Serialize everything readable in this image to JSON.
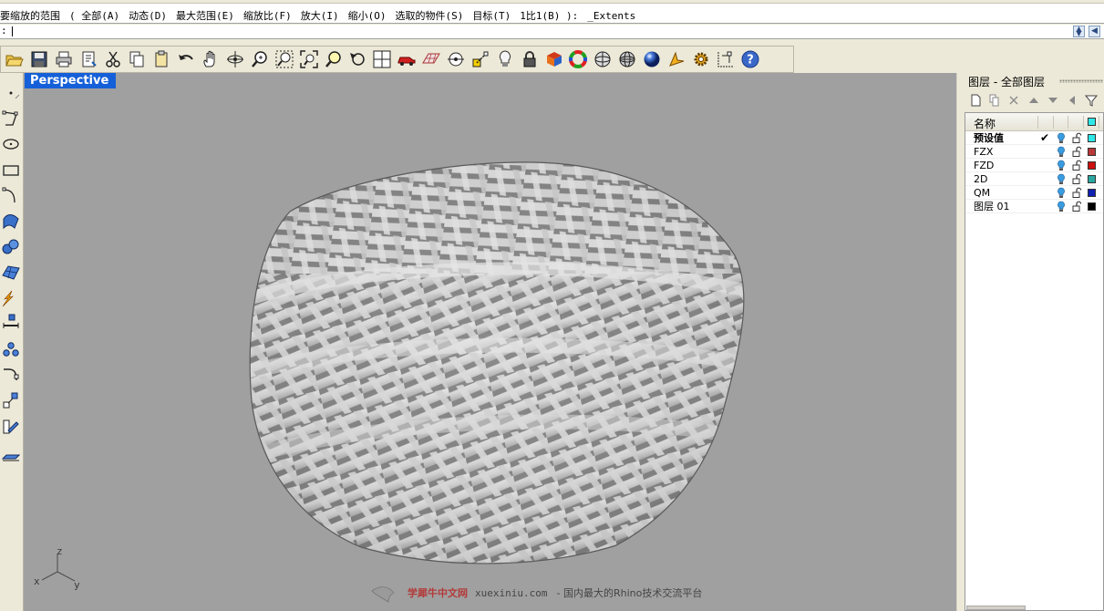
{
  "command_history": {
    "items": [
      "要缩放的范围",
      "( 全部(A)",
      "动态(D)",
      "最大范围(E)",
      "缩放比(F)",
      "放大(I)",
      "缩小(O)",
      "选取的物件(S)",
      "目标(T)",
      "1比1(B) ):",
      "_Extents"
    ]
  },
  "command_prompt": {
    "label": ":",
    "value": ""
  },
  "main_toolbar": {
    "icons": [
      "open-file-icon",
      "save-icon",
      "print-icon",
      "import-export-icon",
      "cut-icon",
      "copy-icon",
      "paste-icon",
      "undo-icon",
      "pan-hand-icon",
      "rotate-view-icon",
      "zoom-dynamic-icon",
      "zoom-window-icon",
      "zoom-extents-icon",
      "zoom-selected-icon",
      "undo-view-icon",
      "four-viewports-icon",
      "car-object-icon",
      "grid-plane-icon",
      "osnap-icon",
      "gumball-icon",
      "light-icon",
      "lock-icon",
      "shade-icon",
      "color-wheel-icon",
      "wire-sphere-icon",
      "mesh-sphere-icon",
      "render-sphere-icon",
      "pointer-flag-icon",
      "gear-settings-icon",
      "dimension-icon",
      "help-icon"
    ]
  },
  "left_toolbar": {
    "icons": [
      "point-icon",
      "polyline-icon",
      "circle-icon",
      "rectangle-icon",
      "curve-icon",
      "surface-icon",
      "solid-spheres-icon",
      "mesh-icon",
      "light-burst-icon",
      "dimension-tool-icon",
      "array-icon",
      "fillet-icon",
      "transform-icon",
      "analyze-icon",
      "ruler-icon"
    ]
  },
  "viewport": {
    "title": "Perspective",
    "axis": {
      "z": "z",
      "y": "y",
      "x": "x"
    },
    "watermark": {
      "brand": "学犀牛中文网",
      "site": "xuexiniu.com",
      "slogan": "- 国内最大的Rhino技术交流平台"
    }
  },
  "layers_panel": {
    "title": "图层 - 全部图层",
    "tools": [
      "new-layer-icon",
      "new-sublayer-icon",
      "delete-layer-icon",
      "move-up-icon",
      "move-down-icon",
      "move-left-icon",
      "filter-icon"
    ],
    "header": {
      "name": "名称"
    },
    "header_color": "#2ee8e8",
    "layers": [
      {
        "name": "预设值",
        "current": true,
        "check": "✔",
        "color": "#2ee8e8"
      },
      {
        "name": "FZX",
        "current": false,
        "check": "",
        "color": "#b83838"
      },
      {
        "name": "FZD",
        "current": false,
        "check": "",
        "color": "#cc1010"
      },
      {
        "name": "2D",
        "current": false,
        "check": "",
        "color": "#2aa7a0"
      },
      {
        "name": "QM",
        "current": false,
        "check": "",
        "color": "#1020b0"
      },
      {
        "name": "图层 01",
        "current": false,
        "check": "",
        "color": "#000000"
      }
    ]
  }
}
